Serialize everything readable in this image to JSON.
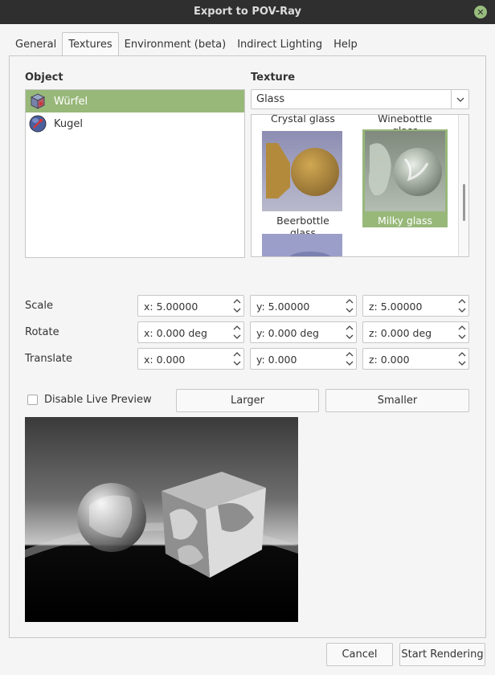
{
  "window": {
    "title": "Export to POV-Ray"
  },
  "tabs": [
    {
      "label": "General"
    },
    {
      "label": "Textures"
    },
    {
      "label": "Environment (beta)"
    },
    {
      "label": "Indirect Lighting"
    },
    {
      "label": "Help"
    }
  ],
  "objects": {
    "header": "Object",
    "items": [
      {
        "label": "Würfel",
        "icon": "cube-icon",
        "selected": true
      },
      {
        "label": "Kugel",
        "icon": "sphere-icon",
        "selected": false
      }
    ]
  },
  "texture": {
    "header": "Texture",
    "category": "Glass",
    "swatches": [
      {
        "label": "Crystal glass"
      },
      {
        "label": "Winebottle glass"
      },
      {
        "label": "Beerbottle glass"
      },
      {
        "label": "Milky glass",
        "selected": true
      }
    ]
  },
  "transform": {
    "scale": {
      "label": "Scale",
      "x": "x: 5.00000",
      "y": "y: 5.00000",
      "z": "z: 5.00000"
    },
    "rotate": {
      "label": "Rotate",
      "x": "x: 0.000 deg",
      "y": "y: 0.000 deg",
      "z": "z: 0.000 deg"
    },
    "translate": {
      "label": "Translate",
      "x": "x: 0.000",
      "y": "y: 0.000",
      "z": "z: 0.000"
    }
  },
  "preview": {
    "disable_label": "Disable Live Preview",
    "disabled": false,
    "larger_label": "Larger",
    "smaller_label": "Smaller"
  },
  "footer": {
    "cancel_label": "Cancel",
    "start_label": "Start Rendering"
  },
  "colors": {
    "accent": "#98b87a",
    "titlebar": "#2f2f2f"
  }
}
